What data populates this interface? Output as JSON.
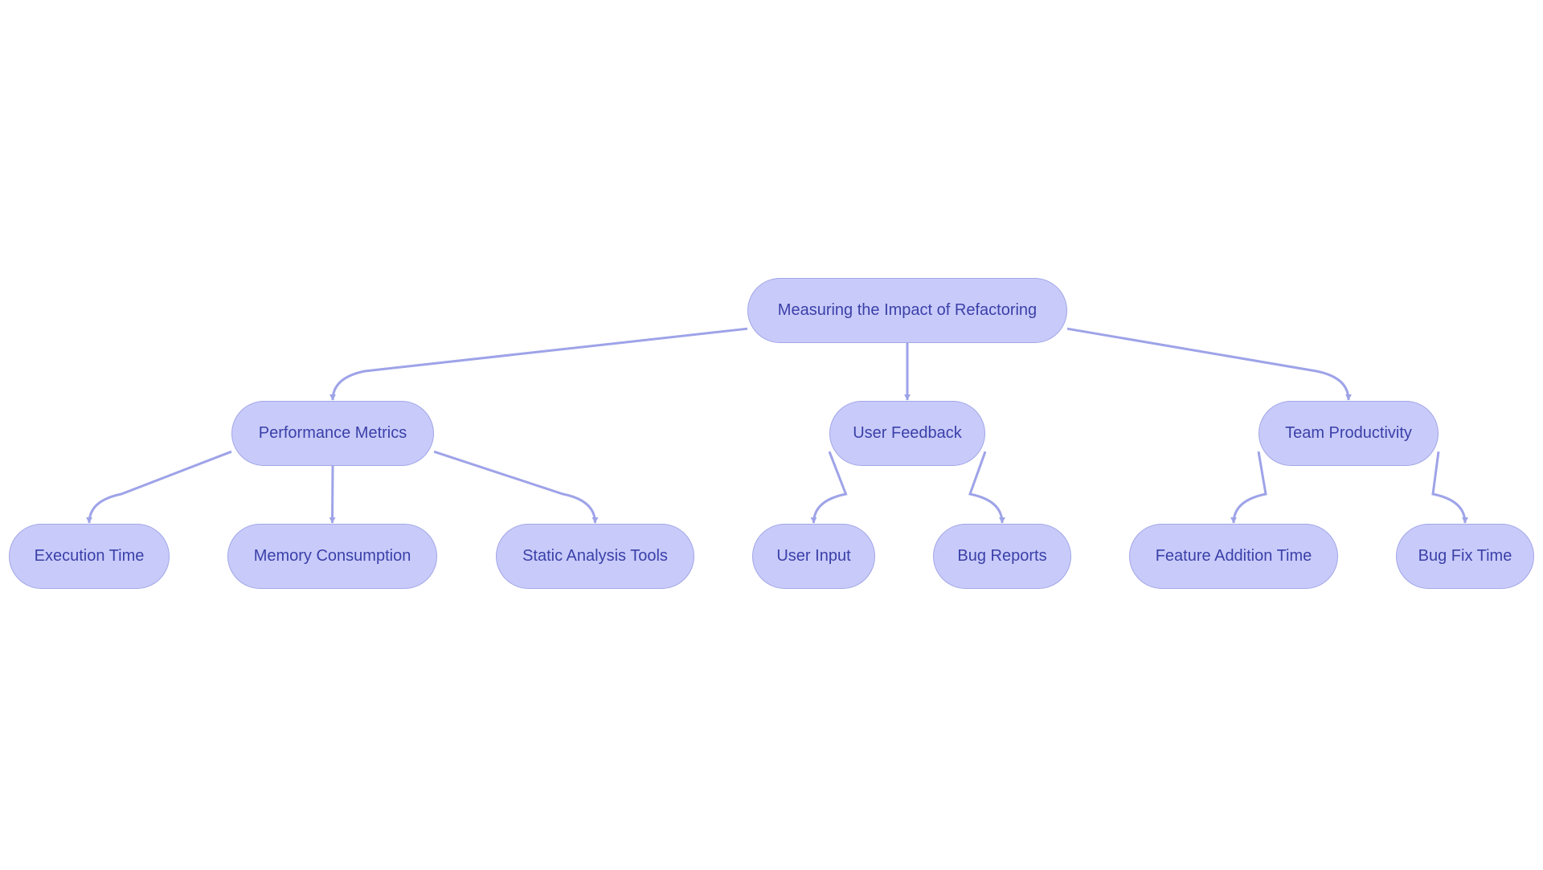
{
  "diagram": {
    "type": "flowchart-tree",
    "colors": {
      "node_fill": "#c8cbfa",
      "node_stroke": "#a2a6e6",
      "text": "#3b40a8",
      "edge": "#9ea3e8"
    },
    "nodes": [
      {
        "id": "root",
        "label": "Measuring the Impact of Refactoring"
      },
      {
        "id": "perf",
        "label": "Performance Metrics"
      },
      {
        "id": "feedback",
        "label": "User Feedback"
      },
      {
        "id": "team",
        "label": "Team Productivity"
      },
      {
        "id": "exec",
        "label": "Execution Time"
      },
      {
        "id": "mem",
        "label": "Memory Consumption"
      },
      {
        "id": "static",
        "label": "Static Analysis Tools"
      },
      {
        "id": "input",
        "label": "User Input"
      },
      {
        "id": "bugrep",
        "label": "Bug Reports"
      },
      {
        "id": "feature",
        "label": "Feature Addition Time"
      },
      {
        "id": "bugfix",
        "label": "Bug Fix Time"
      }
    ],
    "edges": [
      {
        "from": "root",
        "to": "perf"
      },
      {
        "from": "root",
        "to": "feedback"
      },
      {
        "from": "root",
        "to": "team"
      },
      {
        "from": "perf",
        "to": "exec"
      },
      {
        "from": "perf",
        "to": "mem"
      },
      {
        "from": "perf",
        "to": "static"
      },
      {
        "from": "feedback",
        "to": "input"
      },
      {
        "from": "feedback",
        "to": "bugrep"
      },
      {
        "from": "team",
        "to": "feature"
      },
      {
        "from": "team",
        "to": "bugfix"
      }
    ]
  }
}
